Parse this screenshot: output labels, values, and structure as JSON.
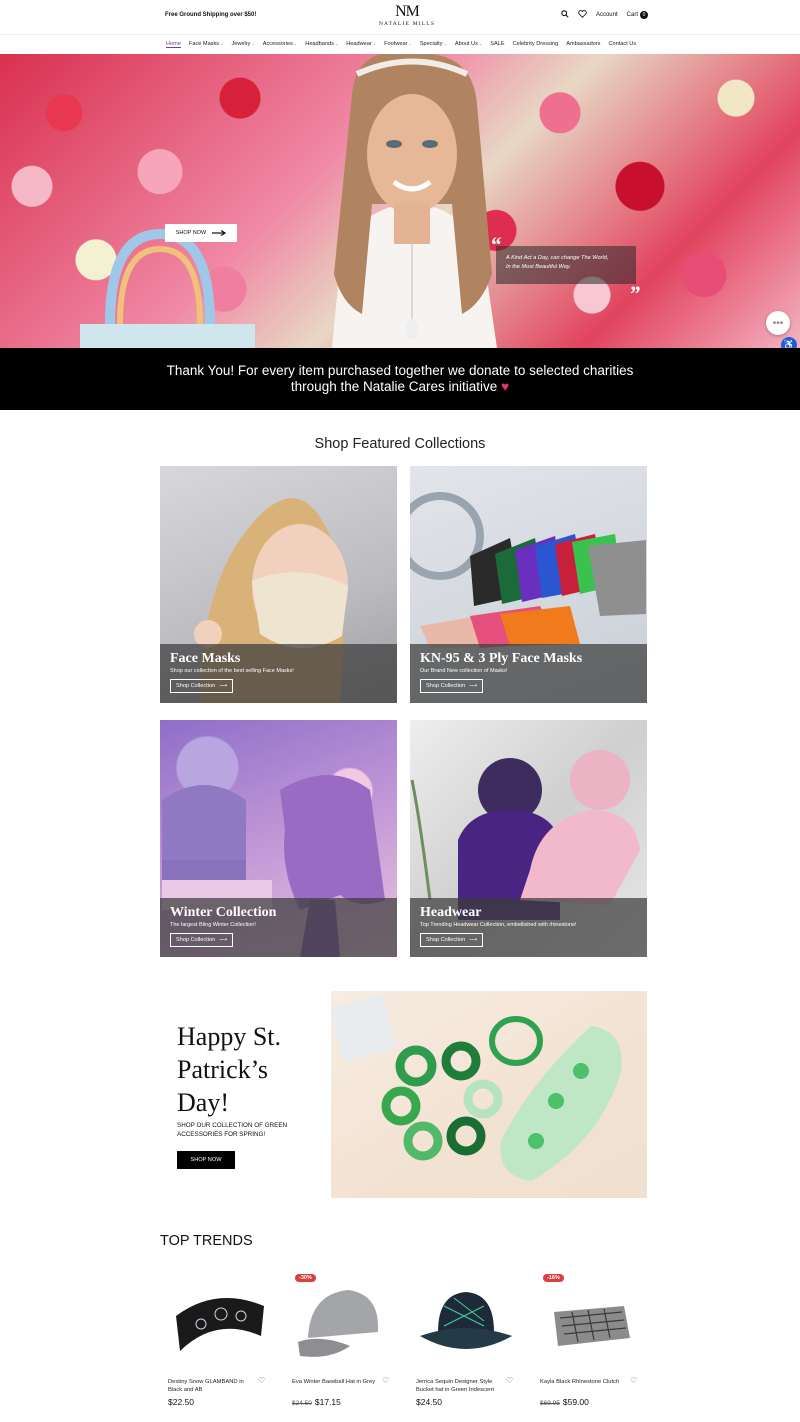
{
  "topbar": {
    "shipping": "Free Ground Shipping over $50!",
    "logo_mark": "NM",
    "logo_text": "NATALIE MILLS",
    "account_label": "Account",
    "cart_label": "Cart",
    "cart_count": "0"
  },
  "nav": {
    "items": [
      {
        "label": "Home"
      },
      {
        "label": "Face Masks"
      },
      {
        "label": "Jewelry"
      },
      {
        "label": "Accessories"
      },
      {
        "label": "Headbands"
      },
      {
        "label": "Headwear"
      },
      {
        "label": "Footwear"
      },
      {
        "label": "Specialty"
      },
      {
        "label": "About Us"
      },
      {
        "label": "SALE"
      },
      {
        "label": "Celebrity Dressing"
      },
      {
        "label": "Ambassadors"
      },
      {
        "label": "Contact Us"
      }
    ]
  },
  "hero": {
    "shop_now": "SHOP NOW",
    "quote_line1": "A Kind Act a Day, can change The World,",
    "quote_line2": "In the Most Beautiful Way."
  },
  "charity": {
    "line1": "Thank You! For every item purchased together we donate to selected charities",
    "line2": "through the Natalie Cares initiative"
  },
  "featured": {
    "title": "Shop Featured Collections",
    "tiles": [
      {
        "title": "Face Masks",
        "subtitle": "Shop our collection of the best selling Face Masks!",
        "button": "Shop Collection"
      },
      {
        "title": "KN-95 & 3 Ply Face Masks",
        "subtitle": "Our Brand New collection of Masks!",
        "button": "Shop Collection"
      },
      {
        "title": "Winter Collection",
        "subtitle": "The largest Bling Winter Collection!",
        "button": "Shop Collection"
      },
      {
        "title": "Headwear",
        "subtitle": "Top Trending Headwear Collection, embellished with rhinestone!",
        "button": "Shop Collection"
      }
    ]
  },
  "promo": {
    "title_l1": "Happy St.",
    "title_l2": "Patrick’s",
    "title_l3": "Day!",
    "subtitle_l1": "SHOP OUR COLLECTION OF GREEN",
    "subtitle_l2": "ACCESSORIES FOR SPRING!",
    "button": "SHOP NOW"
  },
  "trends": {
    "title": "TOP TRENDS",
    "products": [
      {
        "name": "Destiny Snow GLAMBAND in Black and AB",
        "price": "$22.50",
        "old_price": "",
        "badge": ""
      },
      {
        "name": "Eva Winter Baseball Hat in Grey",
        "price": "$17.15",
        "old_price": "$24.50",
        "badge": "-30%"
      },
      {
        "name": "Jerrica Sequin Designer Style Bucket hat in Green Iridescent",
        "price": "$24.50",
        "old_price": "",
        "badge": ""
      },
      {
        "name": "Kayla Black Rhinestone Clutch",
        "price": "$59.00",
        "old_price": "$69.95",
        "badge": "-16%"
      }
    ]
  },
  "colors": {
    "accent": "#6b3fa0",
    "badge": "#d8403d",
    "heart": "#e7366a",
    "accessibility": "#1f5fd1"
  }
}
